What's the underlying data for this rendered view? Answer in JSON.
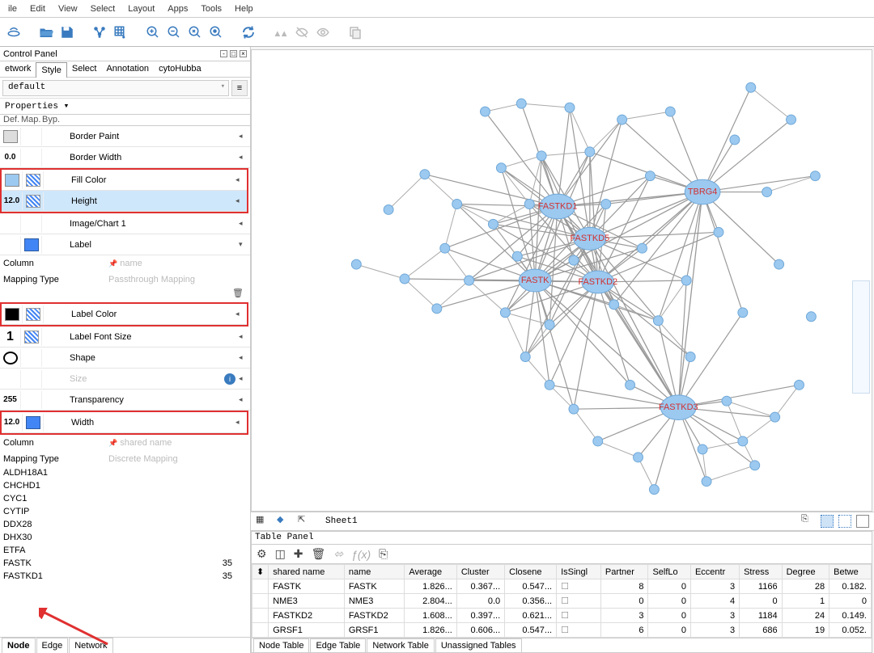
{
  "menu": [
    "ile",
    "Edit",
    "View",
    "Select",
    "Layout",
    "Apps",
    "Tools",
    "Help"
  ],
  "control_panel": {
    "title": "Control Panel",
    "tabs": [
      "etwork",
      "Style",
      "Select",
      "Annotation",
      "cytoHubba"
    ],
    "active_tab": "Style",
    "combo": "default",
    "properties_header": "Properties ▾",
    "col_headers": [
      "Def.",
      "Map.",
      "Byp."
    ]
  },
  "properties": [
    {
      "def_type": "swatch-gray",
      "map": "",
      "label": "Border Paint",
      "tri": "◂"
    },
    {
      "def_type": "text",
      "def": "0.0",
      "map": "",
      "label": "Border Width",
      "tri": "◂"
    },
    {
      "def_type": "swatch-blue",
      "map": "grid",
      "label": "Fill Color",
      "tri": "◂",
      "boxed": true
    },
    {
      "def_type": "text",
      "def": "12.0",
      "map": "grid",
      "label": "Height",
      "tri": "◂",
      "boxed": true,
      "sel": true
    },
    {
      "def_type": "",
      "map": "",
      "label": "Image/Chart 1",
      "tri": "◂"
    },
    {
      "def_type": "",
      "map": "blue",
      "label": "Label",
      "tri": "▾"
    }
  ],
  "label_detail": {
    "column_k": "Column",
    "column_v": "name",
    "mapping_k": "Mapping Type",
    "mapping_v": "Passthrough Mapping"
  },
  "properties2": [
    {
      "def_type": "swatch-black",
      "map": "grid",
      "label": "Label Color",
      "tri": "◂",
      "boxed": true
    },
    {
      "def_type": "text",
      "def": "1",
      "map": "grid",
      "label": "Label Font Size",
      "tri": "◂"
    },
    {
      "def_type": "circle",
      "map": "",
      "label": "Shape",
      "tri": "◂"
    },
    {
      "def_type": "",
      "map": "",
      "label": "Size",
      "tri": "◂",
      "light": true,
      "info": true
    },
    {
      "def_type": "text",
      "def": "255",
      "map": "",
      "label": "Transparency",
      "tri": "◂"
    },
    {
      "def_type": "text",
      "def": "12.0",
      "map": "blue-solid",
      "label": "Width",
      "tri": "◂",
      "boxed": true
    }
  ],
  "width_detail": {
    "column_k": "Column",
    "column_v": "shared name",
    "mapping_k": "Mapping Type",
    "mapping_v": "Discrete Mapping",
    "list": [
      {
        "name": "ALDH18A1"
      },
      {
        "name": "CHCHD1"
      },
      {
        "name": "CYC1"
      },
      {
        "name": "CYTIP"
      },
      {
        "name": "DDX28"
      },
      {
        "name": "DHX30"
      },
      {
        "name": "ETFA"
      },
      {
        "name": "FASTK",
        "val": "35"
      },
      {
        "name": "FASTKD1",
        "val": "35"
      }
    ]
  },
  "bottom_tabs": [
    "Node",
    "Edge",
    "Network"
  ],
  "bottom_active": "Node",
  "canvas": {
    "sheet": "Sheet1",
    "labeled_nodes": [
      "FASTKD1",
      "TBRG4",
      "FASTKD5",
      "FASTK",
      "FASTKD2",
      "FASTKD3"
    ]
  },
  "table_panel": {
    "title": "Table Panel",
    "columns": [
      "",
      "shared name",
      "name",
      "Average",
      "Cluster",
      "Closene",
      "IsSingl",
      "Partner",
      "SelfLo",
      "Eccentr",
      "Stress",
      "Degree",
      "Betwe"
    ],
    "rows": [
      [
        "FASTK",
        "FASTK",
        "1.826...",
        "0.367...",
        "0.547...",
        "",
        "8",
        "0",
        "3",
        "1166",
        "28",
        "0.182."
      ],
      [
        "NME3",
        "NME3",
        "2.804...",
        "0.0",
        "0.356...",
        "",
        "0",
        "0",
        "4",
        "0",
        "1",
        "0"
      ],
      [
        "FASTKD2",
        "FASTKD2",
        "1.608...",
        "0.397...",
        "0.621...",
        "",
        "3",
        "0",
        "3",
        "1184",
        "24",
        "0.149."
      ],
      [
        "GRSF1",
        "GRSF1",
        "1.826...",
        "0.606...",
        "0.547...",
        "",
        "6",
        "0",
        "3",
        "686",
        "19",
        "0.052."
      ]
    ],
    "bottom_tabs": [
      "Node Table",
      "Edge Table",
      "Network Table",
      "Unassigned Tables"
    ],
    "bottom_active": "Node Table"
  }
}
